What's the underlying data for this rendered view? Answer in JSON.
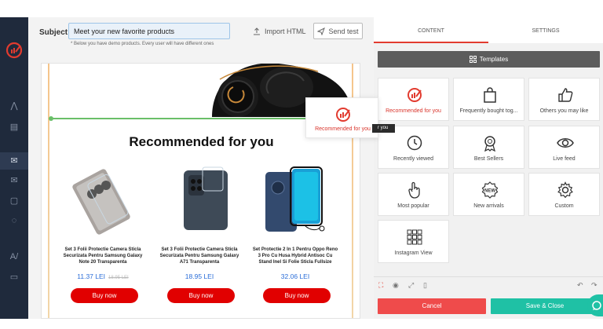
{
  "editor": {
    "subject_label": "Subject",
    "subject_value": "Meet your new favorite products",
    "subject_note": "* Below you have demo products. Every user will have different ones",
    "import_label": "Import HTML",
    "send_test_label": "Send test"
  },
  "email": {
    "section_title": "Recommended for you",
    "products": [
      {
        "name": "Set 3 Folii Protectie Camera Sticla Securizata Pentru Samsung Galaxy Note 20 Transparenta",
        "price": "11.37 LEI",
        "old_price": "18.95 LEI",
        "button": "Buy now"
      },
      {
        "name": "Set 3 Folii Protectie Camera Sticla Securizata Pentru Samsung Galaxy A71 Transparenta",
        "price": "18.95 LEI",
        "old_price": "",
        "button": "Buy now"
      },
      {
        "name": "Set Protectie 2 In 1 Pentru Oppo Reno 3 Pro Cu Husa Hybrid Antisoc Cu Stand Inel Si Folie Sticla Fullsize",
        "price": "32.06 LEI",
        "old_price": "",
        "button": "Buy now"
      }
    ]
  },
  "drag_ghost": {
    "label": "Recommended for you",
    "tooltip": "r you"
  },
  "panel": {
    "tabs": [
      {
        "label": "CONTENT"
      },
      {
        "label": "SETTINGS"
      }
    ],
    "templates_label": "Templates",
    "tiles": [
      {
        "label": "Recommended for you",
        "icon": "recommended-icon"
      },
      {
        "label": "Frequently bought tog...",
        "icon": "shopping-bag-icon"
      },
      {
        "label": "Others you may like",
        "icon": "thumbs-up-icon"
      },
      {
        "label": "Recently viewed",
        "icon": "clock-icon"
      },
      {
        "label": "Best Sellers",
        "icon": "badge-icon"
      },
      {
        "label": "Live feed",
        "icon": "eye-icon"
      },
      {
        "label": "Most popular",
        "icon": "pointer-icon"
      },
      {
        "label": "New arrivals",
        "icon": "new-badge-icon"
      },
      {
        "label": "Custom",
        "icon": "gear-icon"
      },
      {
        "label": "Instagram View",
        "icon": "grid-icon"
      }
    ],
    "cancel_label": "Cancel",
    "save_label": "Save & Close"
  },
  "colors": {
    "accent": "#e23b2f",
    "rail": "#1f2a3c",
    "buy": "#e10000",
    "save": "#1fc1a5",
    "cancel": "#ef4b4b"
  }
}
